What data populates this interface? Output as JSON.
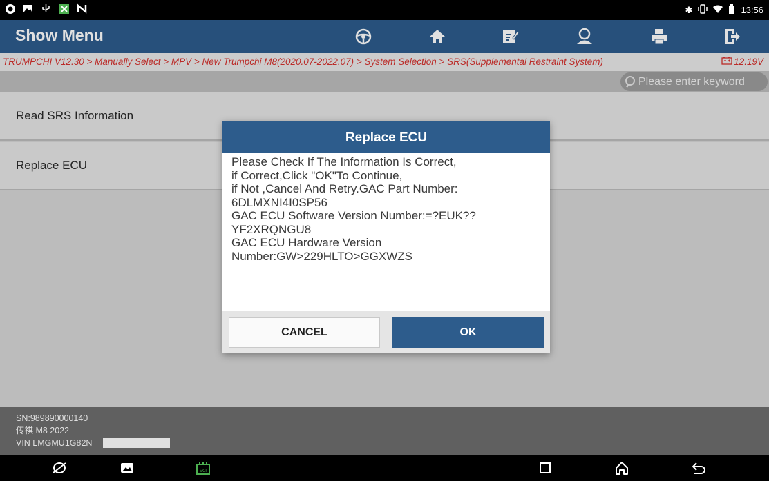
{
  "status_bar": {
    "left_icons": [
      "browser-icon",
      "gallery-notification-icon",
      "usb-icon",
      "app-notification-icon",
      "nfc-icon"
    ],
    "right_icons": [
      "bluetooth-icon",
      "vibrate-icon",
      "wifi-icon",
      "battery-icon"
    ],
    "time": "13:56"
  },
  "header": {
    "title": "Show Menu",
    "toolbar_icons": [
      "steering-wheel-icon",
      "home-icon",
      "edit-report-icon",
      "user-icon",
      "print-icon",
      "exit-icon"
    ]
  },
  "breadcrumb": {
    "path": "TRUMPCHI V12.30 > Manually Select > MPV > New Trumpchi M8(2020.07-2022.07) > System Selection > SRS(Supplemental Restraint System)",
    "voltage": "12.19V"
  },
  "search": {
    "placeholder": "Please enter keyword"
  },
  "menu": {
    "items": [
      {
        "label": "Read SRS Information"
      },
      {
        "label": "Replace ECU"
      }
    ]
  },
  "dialog": {
    "title": "Replace ECU",
    "message": "Please Check If The Information Is Correct,\nif Correct,Click \"OK\"To Continue,\nif Not ,Cancel And Retry.GAC Part Number:\n6DLMXNI4I0SP56\nGAC ECU Software Version Number:=?EUK??\nYF2XRQNGU8\nGAC ECU Hardware Version\nNumber:GW>229HLTO>GGXWZS",
    "cancel_label": "CANCEL",
    "ok_label": "OK"
  },
  "info": {
    "sn": "SN:989890000140",
    "vehicle": "传祺 M8 2022",
    "vin": "VIN LMGMU1G82N"
  },
  "nav_bar": {
    "icons": [
      "browser-icon",
      "gallery-icon",
      "vci-icon",
      "recents-icon",
      "home-icon",
      "back-icon"
    ]
  },
  "colors": {
    "primary": "#2d5c8c",
    "breadcrumb_text": "#d5322e",
    "vci_green": "#4caf50"
  }
}
